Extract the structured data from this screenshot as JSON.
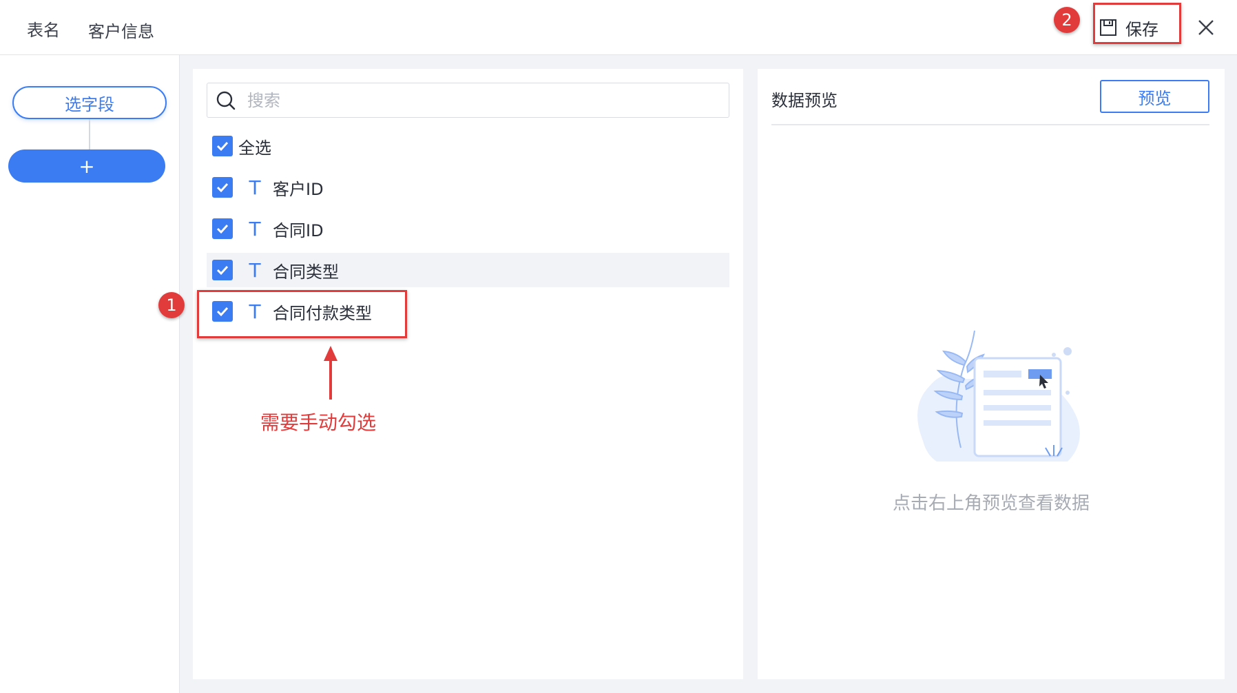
{
  "header": {
    "label": "表名",
    "table_name": "客户信息",
    "save_label": "保存",
    "save_icon": "save-icon",
    "close_icon": "close-icon"
  },
  "flow": {
    "node_label": "选字段",
    "add_label": "+"
  },
  "fields": {
    "search_placeholder": "搜索",
    "select_all_label": "全选",
    "items": [
      {
        "label": "客户ID",
        "type_icon": "T",
        "checked": true
      },
      {
        "label": "合同ID",
        "type_icon": "T",
        "checked": true
      },
      {
        "label": "合同类型",
        "type_icon": "T",
        "checked": true
      },
      {
        "label": "合同付款类型",
        "type_icon": "T",
        "checked": true
      }
    ]
  },
  "preview": {
    "title": "数据预览",
    "button_label": "预览",
    "empty_text": "点击右上角预览查看数据"
  },
  "annotations": {
    "step1": "1",
    "step2": "2",
    "note": "需要手动勾选",
    "color": "#e23b3b"
  },
  "colors": {
    "accent": "#3b7cf2",
    "background": "#f2f3f6"
  }
}
